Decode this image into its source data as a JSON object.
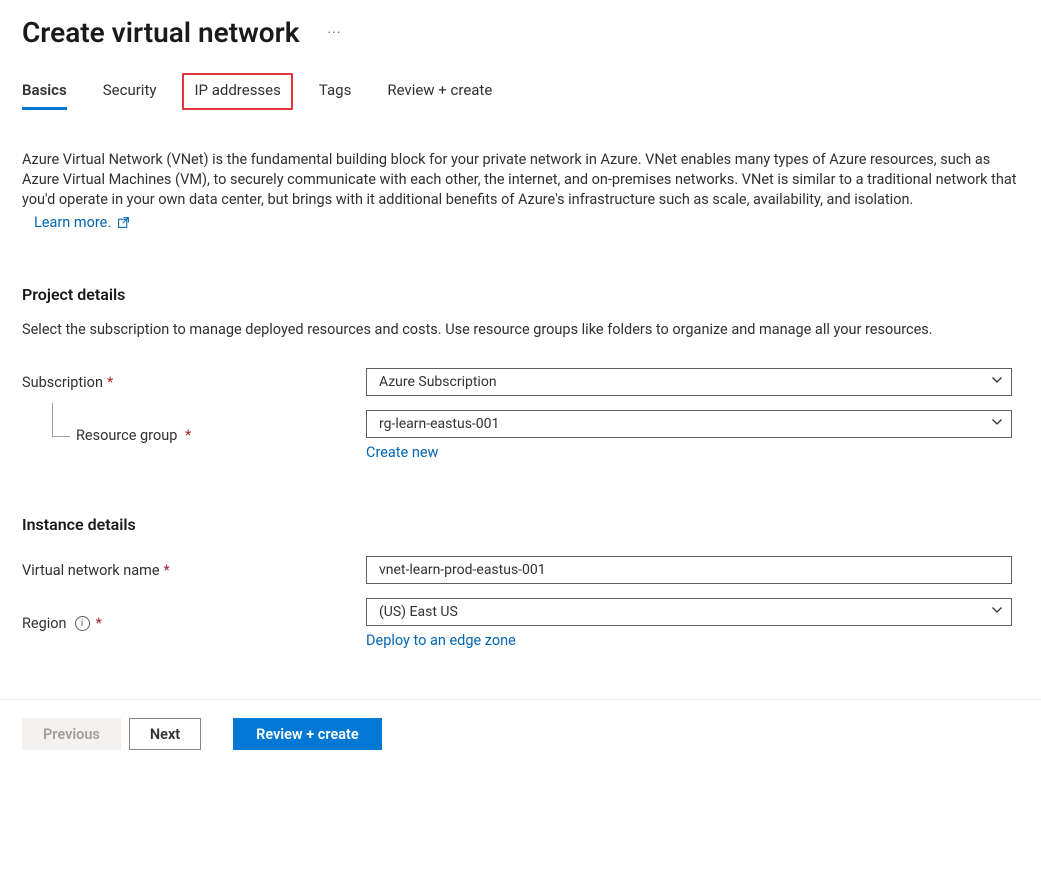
{
  "header": {
    "title": "Create virtual network"
  },
  "tabs": {
    "basics": "Basics",
    "security": "Security",
    "ip": "IP addresses",
    "tags": "Tags",
    "review": "Review + create"
  },
  "intro": {
    "text": "Azure Virtual Network (VNet) is the fundamental building block for your private network in Azure. VNet enables many types of Azure resources, such as Azure Virtual Machines (VM), to securely communicate with each other, the internet, and on-premises networks. VNet is similar to a traditional network that you'd operate in your own data center, but brings with it additional benefits of Azure's infrastructure such as scale, availability, and isolation.",
    "learn_more": "Learn more."
  },
  "project": {
    "heading": "Project details",
    "desc": "Select the subscription to manage deployed resources and costs. Use resource groups like folders to organize and manage all your resources.",
    "subscription_label": "Subscription",
    "subscription_value": "Azure Subscription",
    "rg_label": "Resource group",
    "rg_value": "rg-learn-eastus-001",
    "create_new": "Create new"
  },
  "instance": {
    "heading": "Instance details",
    "name_label": "Virtual network name",
    "name_value": "vnet-learn-prod-eastus-001",
    "region_label": "Region",
    "region_value": "(US) East US",
    "edge_link": "Deploy to an edge zone"
  },
  "footer": {
    "previous": "Previous",
    "next": "Next",
    "review": "Review + create"
  }
}
